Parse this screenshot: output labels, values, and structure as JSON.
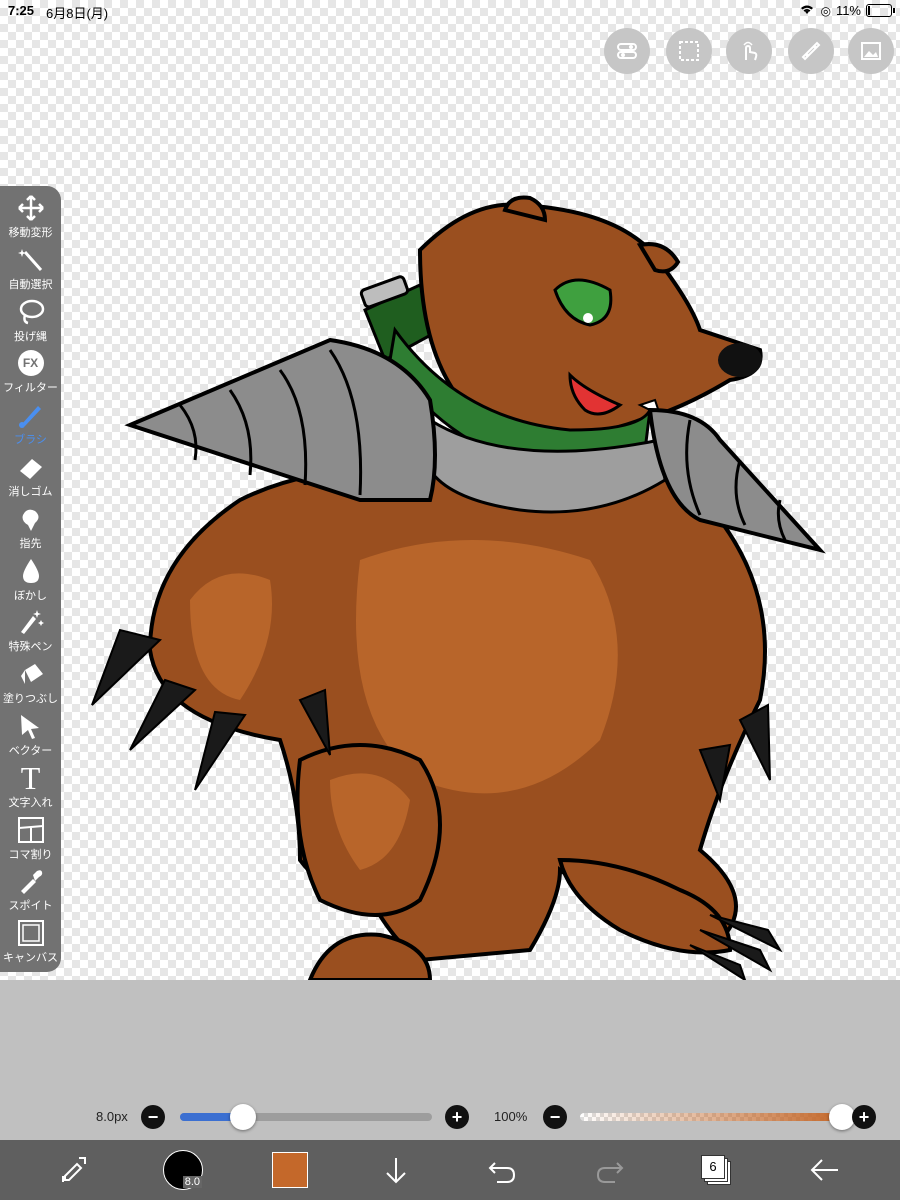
{
  "status": {
    "time": "7:25",
    "date": "6月8日(月)",
    "battery": "11%",
    "battery_level": 0.11
  },
  "top_buttons": [
    {
      "name": "toggle-icon"
    },
    {
      "name": "selection-icon"
    },
    {
      "name": "touch-icon"
    },
    {
      "name": "ruler-icon"
    },
    {
      "name": "image-icon"
    }
  ],
  "tools": [
    {
      "label": "移動変形",
      "icon": "move-icon",
      "active": false
    },
    {
      "label": "自動選択",
      "icon": "magic-wand-icon",
      "active": false
    },
    {
      "label": "投げ縄",
      "icon": "lasso-icon",
      "active": false
    },
    {
      "label": "フィルター",
      "icon": "fx-icon",
      "active": false,
      "glyph": "FX"
    },
    {
      "label": "ブラシ",
      "icon": "brush-icon",
      "active": true
    },
    {
      "label": "消しゴム",
      "icon": "eraser-icon",
      "active": false
    },
    {
      "label": "指先",
      "icon": "finger-icon",
      "active": false
    },
    {
      "label": "ぼかし",
      "icon": "blur-icon",
      "active": false
    },
    {
      "label": "特殊ペン",
      "icon": "special-pen-icon",
      "active": false
    },
    {
      "label": "塗りつぶし",
      "icon": "fill-icon",
      "active": false
    },
    {
      "label": "ベクター",
      "icon": "vector-icon",
      "active": false
    },
    {
      "label": "文字入れ",
      "icon": "text-icon",
      "active": false,
      "glyph": "T"
    },
    {
      "label": "コマ割り",
      "icon": "frame-icon",
      "active": false
    },
    {
      "label": "スポイト",
      "icon": "eyedropper-icon",
      "active": false
    },
    {
      "label": "キャンバス",
      "icon": "canvas-icon",
      "active": false
    }
  ],
  "brush": {
    "size_label": "8.0px",
    "size_level": 0.25,
    "opacity_label": "100%",
    "opacity_level": 1.0,
    "minus": "−",
    "plus": "+"
  },
  "bottom": {
    "brush_preview": "8.0",
    "layer_count": "6",
    "color": "#c4682a"
  },
  "colors": {
    "accent": "#4a8ff0",
    "toolbar": "#5f5f5f",
    "tool_panel": "#727272",
    "panel": "#c0c0c0"
  }
}
